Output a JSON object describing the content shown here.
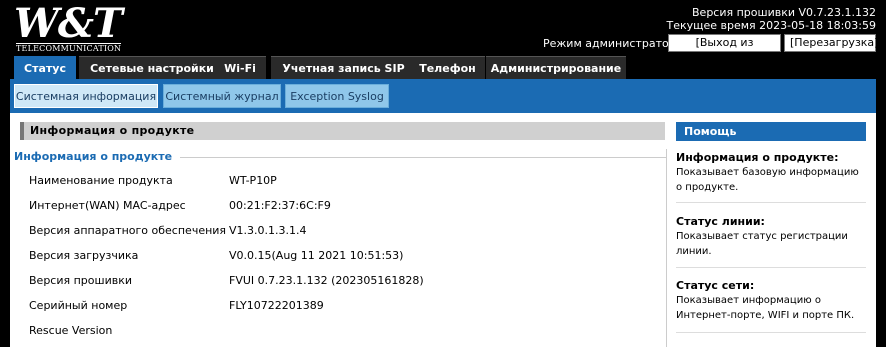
{
  "brand": {
    "logo_text": "W&T",
    "logo_sub": "TELECOMMUNICATION"
  },
  "header": {
    "firmware_line": "Версия прошивки V0.7.23.1.132",
    "time_line": "Текущее время 2023-05-18 18:03:59",
    "mode_label": "Режим администратора",
    "logout_button": "[Выход из системы]",
    "reboot_button": "[Перезагрузка]"
  },
  "tabs": [
    {
      "label": "Статус"
    },
    {
      "label": "Сетевые настройки"
    },
    {
      "label": "Wi-Fi"
    },
    {
      "label": "Учетная запись SIP"
    },
    {
      "label": "Телефон"
    },
    {
      "label": "Администрирование"
    }
  ],
  "subtabs": [
    {
      "label": "Системная информация"
    },
    {
      "label": "Системный журнал"
    },
    {
      "label": "Exception Syslog"
    }
  ],
  "content": {
    "section_header": "Информация о продукте",
    "fieldset_legend": "Информация о продукте",
    "rows": [
      {
        "key": "Наименование продукта",
        "value": "WT-P10P"
      },
      {
        "key": "Интернет(WAN) MAC-адрес",
        "value": "00:21:F2:37:6C:F9"
      },
      {
        "key": "Версия аппаратного обеспечения",
        "value": "V1.3.0.1.3.1.4"
      },
      {
        "key": "Версия загрузчика",
        "value": "V0.0.15(Aug 11 2021 10:51:53)"
      },
      {
        "key": "Версия прошивки",
        "value": "FVUI 0.7.23.1.132 (202305161828)"
      },
      {
        "key": "Серийный номер",
        "value": "FLY10722201389"
      },
      {
        "key": "Rescue Version",
        "value": ""
      }
    ]
  },
  "help": {
    "title": "Помощь",
    "items": [
      {
        "title": "Информация о продукте:",
        "text": "Показывает базовую информацию о продукте."
      },
      {
        "title": "Статус линии:",
        "text": "Показывает статус регистрации линии."
      },
      {
        "title": "Статус сети:",
        "text": "Показывает информацию о Интернет-порте, WIFI и порте ПК."
      }
    ]
  },
  "colors": {
    "accent": "#1b6bb3",
    "subtab": "#8fc7ea",
    "subtab_active": "#cfe8f7",
    "header_bg": "#000000"
  }
}
